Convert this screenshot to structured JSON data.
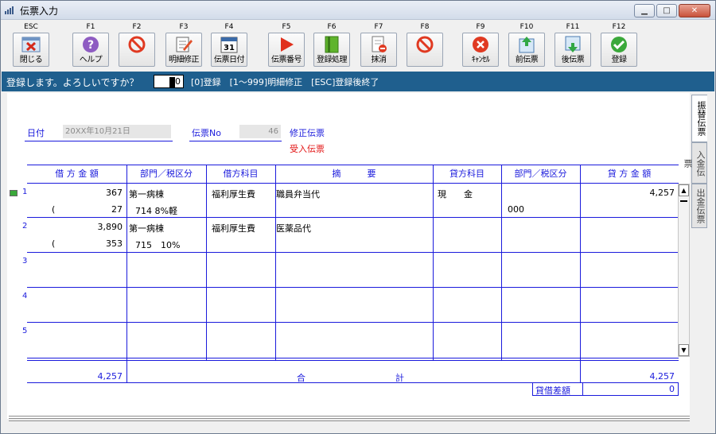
{
  "window": {
    "title": "伝票入力"
  },
  "toolbar": [
    {
      "key": "ESC",
      "label": "閉じる",
      "icon": "close-window-icon"
    },
    {
      "key": "F1",
      "label": "ヘルプ",
      "icon": "help-icon"
    },
    {
      "key": "F2",
      "label": "",
      "icon": "prohibited-icon"
    },
    {
      "key": "F3",
      "label": "明細修正",
      "icon": "edit-detail-icon"
    },
    {
      "key": "F4",
      "label": "伝票日付",
      "icon": "calendar-icon"
    },
    {
      "key": "F5",
      "label": "伝票番号",
      "icon": "play-icon"
    },
    {
      "key": "F6",
      "label": "登録処理",
      "icon": "register-book-icon"
    },
    {
      "key": "F7",
      "label": "抹消",
      "icon": "delete-document-icon"
    },
    {
      "key": "F8",
      "label": "",
      "icon": "prohibited-icon"
    },
    {
      "key": "F9",
      "label": "ｷｬﾝｾﾙ",
      "icon": "cancel-icon"
    },
    {
      "key": "F10",
      "label": "前伝票",
      "icon": "previous-voucher-icon"
    },
    {
      "key": "F11",
      "label": "後伝票",
      "icon": "next-voucher-icon"
    },
    {
      "key": "F12",
      "label": "登録",
      "icon": "check-icon"
    }
  ],
  "status": {
    "prompt": "登録します。よろしいですか？",
    "input_value": "0",
    "options": "[0]登録　[1～999]明細修正　[ESC]登録後終了"
  },
  "header": {
    "date_label": "日付",
    "date_value": "20XX年10月21日",
    "voucher_no_label": "伝票No",
    "voucher_no_value": "46",
    "mode_label": "修正伝票",
    "type_label": "受入伝票"
  },
  "columns": {
    "debit_amount": "借 方 金 額",
    "debit_dept": "部門／税区分",
    "debit_account": "借方科目",
    "summary": "摘　　　要",
    "credit_account": "貸方科目",
    "credit_dept": "部門／税区分",
    "credit_amount": "貸 方 金 額"
  },
  "rows": [
    {
      "no": "1",
      "debit_amount": "367",
      "debit_tax_prefix": "(",
      "debit_tax": "27",
      "debit_dept": "第一病棟",
      "debit_tax_code": "714 8%軽",
      "debit_account": "福利厚生費",
      "summary": "職員弁当代",
      "credit_account": "現　　金",
      "credit_dept": "",
      "credit_tax_code": "000",
      "credit_amount": "4,257"
    },
    {
      "no": "2",
      "debit_amount": "3,890",
      "debit_tax_prefix": "(",
      "debit_tax": "353",
      "debit_dept": "第一病棟",
      "debit_tax_code": "715　10%",
      "debit_account": "福利厚生費",
      "summary": "医薬品代",
      "credit_account": "",
      "credit_dept": "",
      "credit_tax_code": "",
      "credit_amount": ""
    },
    {
      "no": "3"
    },
    {
      "no": "4"
    },
    {
      "no": "5"
    }
  ],
  "totals": {
    "debit_total": "4,257",
    "label_left": "合",
    "label_right": "計",
    "credit_total": "4,257",
    "difference_label": "貸借差額",
    "difference_value": "0"
  },
  "side_tabs": [
    "振替伝票",
    "入金伝票",
    "出金伝票"
  ],
  "colors": {
    "accent_blue": "#1a1adc",
    "status_bar": "#1f5f8e",
    "alert_red": "#e21010"
  }
}
